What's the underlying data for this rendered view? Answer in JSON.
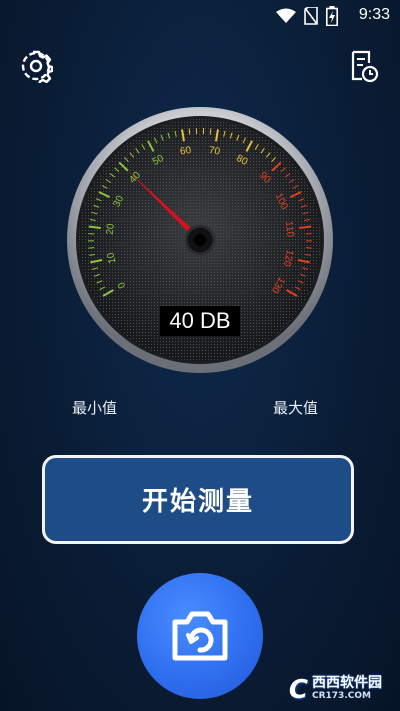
{
  "status_bar": {
    "time": "9:33",
    "icons": [
      "wifi-icon",
      "no-sim-icon",
      "battery-charging-icon"
    ]
  },
  "header": {
    "settings_icon": "gear-icon",
    "history_icon": "document-clock-icon"
  },
  "gauge": {
    "scale_labels": [
      "0",
      "10",
      "20",
      "30",
      "40",
      "50",
      "60",
      "70",
      "80",
      "90",
      "100",
      "110",
      "120",
      "130"
    ],
    "needle_value": 40,
    "min": 0,
    "max": 130,
    "readout": "40 DB",
    "colors": {
      "low": "#8cc63f",
      "mid": "#e8c23a",
      "high": "#e0401e",
      "needle": "#d8101e"
    }
  },
  "stats": {
    "min_label": "最小值",
    "max_label": "最大值"
  },
  "actions": {
    "start_label": "开始测量",
    "camera_icon": "camera-rotate-icon"
  },
  "watermark": {
    "brand": "西西软件园",
    "site": "CR173.COM"
  }
}
